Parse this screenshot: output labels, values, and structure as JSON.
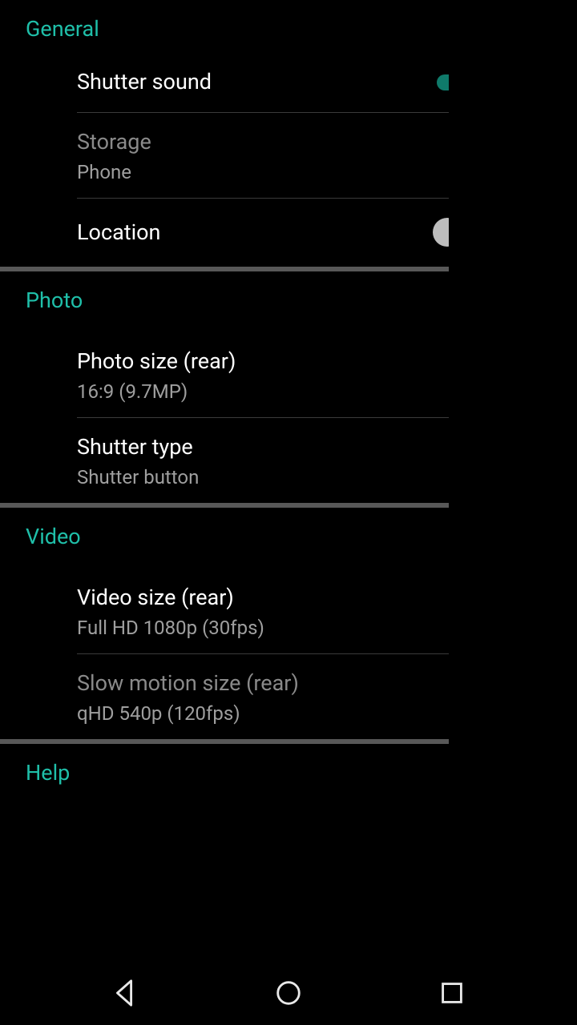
{
  "sections": {
    "general": {
      "header": "General",
      "shutter_sound": {
        "title": "Shutter sound",
        "on": true
      },
      "storage": {
        "title": "Storage",
        "value": "Phone",
        "disabled": true
      },
      "location": {
        "title": "Location",
        "on": false
      }
    },
    "photo": {
      "header": "Photo",
      "photo_size": {
        "title": "Photo size (rear)",
        "value": "16:9 (9.7MP)"
      },
      "shutter_type": {
        "title": "Shutter type",
        "value": "Shutter button"
      }
    },
    "video": {
      "header": "Video",
      "video_size": {
        "title": "Video size (rear)",
        "value": "Full HD 1080p (30fps)"
      },
      "slow_motion": {
        "title": "Slow motion size (rear)",
        "value": "qHD 540p (120fps)",
        "disabled": true
      }
    },
    "help": {
      "header": "Help"
    }
  },
  "colors": {
    "accent": "#1fbfa9",
    "accent_dark": "#0f7a6a",
    "text_primary": "#ffffff",
    "text_secondary": "#9f9f9f",
    "text_disabled": "#8a8a8a"
  }
}
